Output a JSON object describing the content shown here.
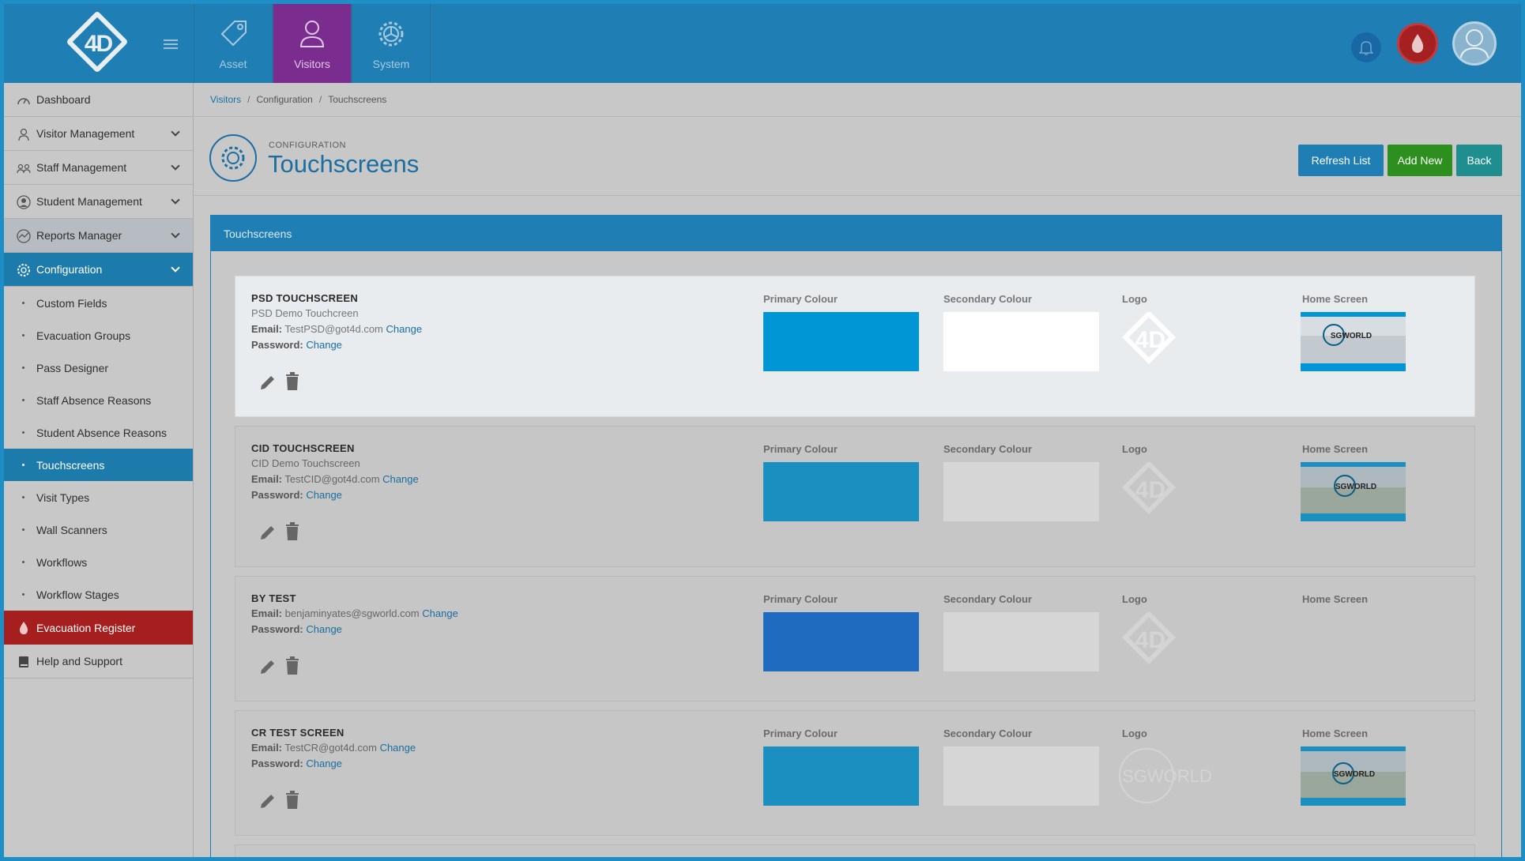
{
  "topbar": {
    "logo_text": "4D",
    "modules": [
      {
        "label": "Asset",
        "icon": "tag-icon"
      },
      {
        "label": "Visitors",
        "icon": "person-icon"
      },
      {
        "label": "System",
        "icon": "gear-icon"
      }
    ]
  },
  "sidebar": {
    "items": [
      {
        "label": "Dashboard"
      },
      {
        "label": "Visitor Management"
      },
      {
        "label": "Staff Management"
      },
      {
        "label": "Student Management"
      },
      {
        "label": "Reports Manager"
      },
      {
        "label": "Configuration"
      }
    ],
    "config_sub": [
      "Custom Fields",
      "Evacuation Groups",
      "Pass Designer",
      "Staff Absence Reasons",
      "Student Absence Reasons",
      "Touchscreens",
      "Visit Types",
      "Wall Scanners",
      "Workflows",
      "Workflow Stages"
    ],
    "evacuation": "Evacuation Register",
    "help": "Help and Support"
  },
  "breadcrumb": [
    "Visitors",
    "Configuration",
    "Touchscreens"
  ],
  "page": {
    "subtitle": "CONFIGURATION",
    "title": "Touchscreens",
    "buttons": {
      "refresh": "Refresh List",
      "add": "Add New",
      "back": "Back"
    }
  },
  "panel": {
    "title": "Touchscreens"
  },
  "labels": {
    "email": "Email:",
    "password": "Password:",
    "change": "Change",
    "primary": "Primary Colour",
    "secondary": "Secondary Colour",
    "logo": "Logo",
    "home": "Home Screen"
  },
  "touchscreens": [
    {
      "name": "PSD TOUCHSCREEN",
      "desc": "PSD Demo Touchcreen",
      "email": "TestPSD@got4d.com",
      "primary": "#0096d6",
      "secondary": "#ffffff",
      "logo": "4D",
      "home": "SGWORLD"
    },
    {
      "name": "CID TOUCHSCREEN",
      "desc": "CID Demo Touchscreen",
      "email": "TestCID@got4d.com",
      "primary": "#1a8fc0",
      "secondary": "#d6d6d6",
      "logo": "4D",
      "home": "SGWORLD"
    },
    {
      "name": "BY TEST",
      "desc": "",
      "email": "benjaminyates@sgworld.com",
      "primary": "#1f6bbf",
      "secondary": "#d6d6d6",
      "logo": "4D",
      "home": ""
    },
    {
      "name": "CR TEST SCREEN",
      "desc": "",
      "email": "TestCR@got4d.com",
      "primary": "#1a8fc0",
      "secondary": "#d6d6d6",
      "logo": "SGWORLD",
      "home": "SGWORLD"
    }
  ]
}
